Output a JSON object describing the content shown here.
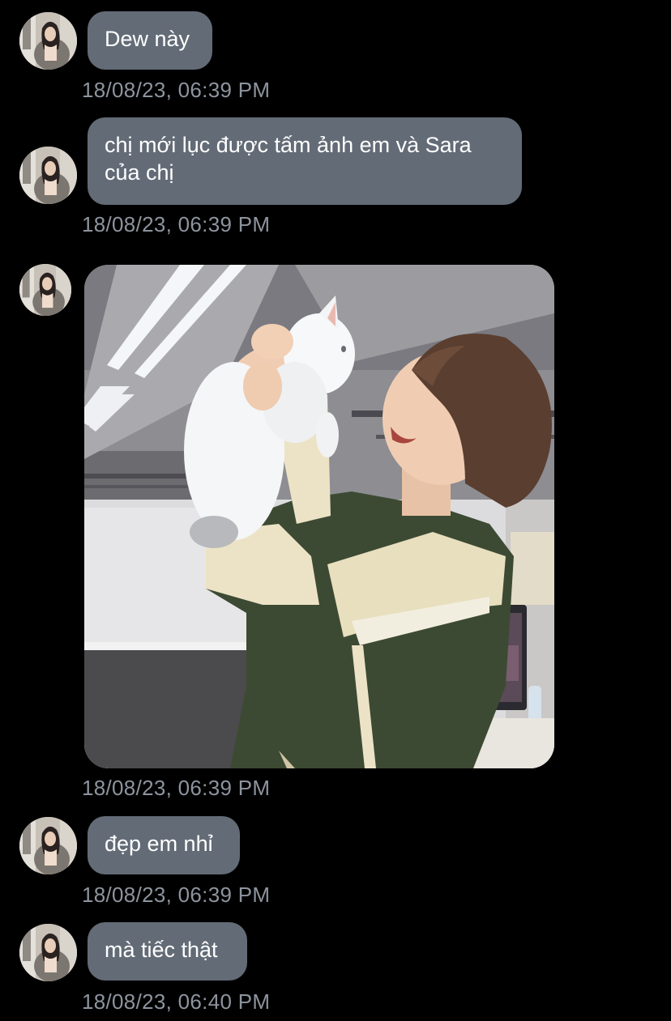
{
  "messages": [
    {
      "type": "text",
      "text": "Dew này",
      "timestamp": "18/08/23, 06:39 PM"
    },
    {
      "type": "text",
      "text": "chị mới lục được tấm ảnh em và Sara\ncủa chị",
      "timestamp": "18/08/23, 06:39 PM"
    },
    {
      "type": "image",
      "image_desc": "photo-man-holding-white-cat",
      "timestamp": "18/08/23, 06:39 PM"
    },
    {
      "type": "text",
      "text": "đẹp em nhỉ",
      "timestamp": "18/08/23, 06:39 PM"
    },
    {
      "type": "text",
      "text": "mà tiếc thật",
      "timestamp": "18/08/23, 06:40 PM"
    }
  ],
  "colors": {
    "background": "#000000",
    "bubble": "#636b76",
    "timestamp": "#8d949e",
    "text": "#ffffff"
  }
}
